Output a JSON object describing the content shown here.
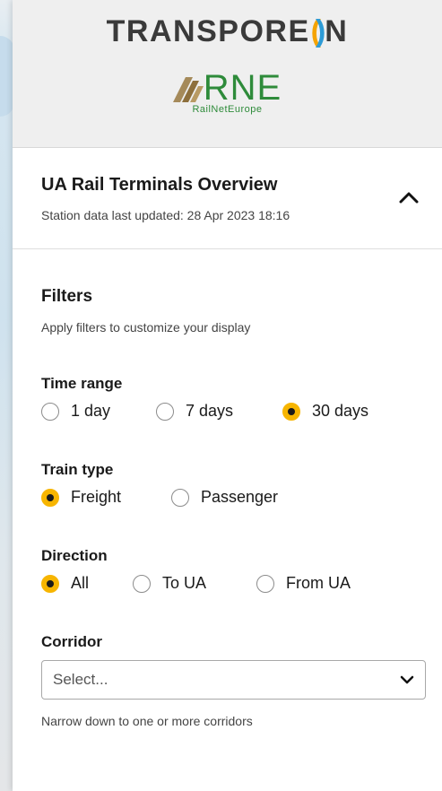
{
  "brand": {
    "transporeon_pre": "TRANSPORE",
    "transporeon_post": "N",
    "rne_letters": "RNE",
    "rne_sub": "RailNetEurope"
  },
  "overview": {
    "title": "UA Rail Terminals Overview",
    "updated": "Station data last updated: 28 Apr 2023 18:16",
    "collapse_icon": "chevron-up-icon"
  },
  "filters": {
    "title": "Filters",
    "subtitle": "Apply filters to customize your display",
    "time_range": {
      "label": "Time range",
      "options": [
        "1 day",
        "7 days",
        "30 days"
      ],
      "selected": "30 days"
    },
    "train_type": {
      "label": "Train type",
      "options": [
        "Freight",
        "Passenger"
      ],
      "selected": "Freight"
    },
    "direction": {
      "label": "Direction",
      "options": [
        "All",
        "To UA",
        "From UA"
      ],
      "selected": "All"
    },
    "corridor": {
      "label": "Corridor",
      "placeholder": "Select...",
      "hint": "Narrow down to one or more corridors"
    }
  },
  "colors": {
    "accent": "#f7b500",
    "rne_green": "#2e8b3a",
    "transporeon_blue": "#2d9bd6"
  }
}
